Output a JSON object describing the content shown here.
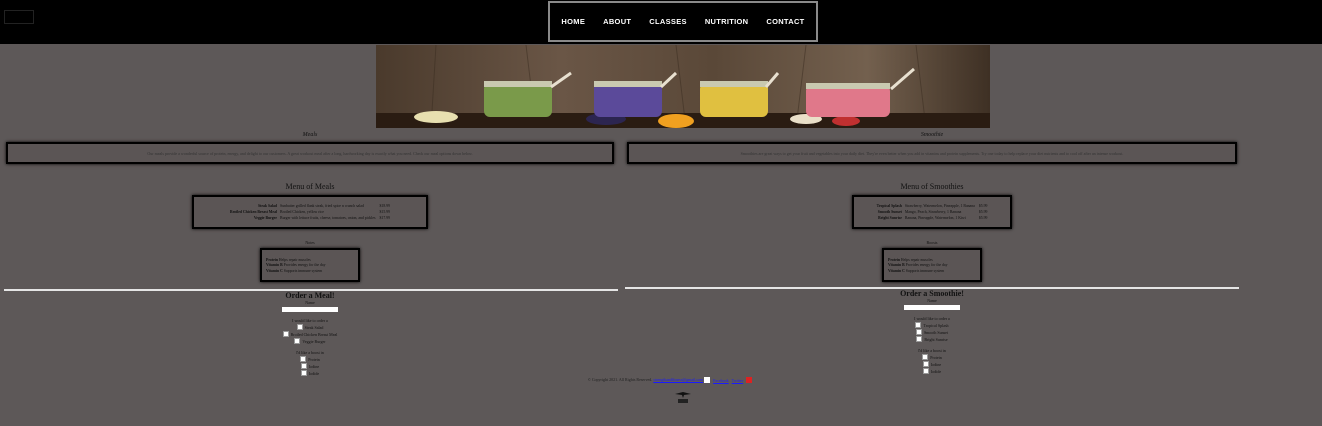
{
  "nav": {
    "items": [
      {
        "label": "HOME"
      },
      {
        "label": "ABOUT"
      },
      {
        "label": "CLASSES"
      },
      {
        "label": "NUTRITION"
      },
      {
        "label": "CONTACT"
      }
    ]
  },
  "meals": {
    "section_label": "Meals",
    "description": "Our meals provide a wonderful source of protein, energy, and delight to our customers. A great workout meal after a long, hardworking day is exactly what you need. Check our meal options down below.",
    "menu_title": "Menu of Meals",
    "menu": [
      {
        "name": "Steak Salad",
        "desc": "Sunbutter grilled flank steak, fried spice n crunch salad",
        "price": "$18.99"
      },
      {
        "name": "Broiled Chicken Breast Meal",
        "desc": "Broiled Chicken, yellow rice",
        "price": "$15.99"
      },
      {
        "name": "Veggie Burger",
        "desc": "Burger with lettuce fruits, cheese, tomatoes, onion, and pickles",
        "price": "$17.99"
      }
    ],
    "benefits_label": "Notes",
    "benefits": [
      {
        "name": "Protein",
        "desc": "Helps repair muscles"
      },
      {
        "name": "Vitamin B",
        "desc": "Provides energy for the day"
      },
      {
        "name": "Vitamin C",
        "desc": "Supports immune system"
      }
    ],
    "order_title": "Order a Meal!",
    "name_label": "Name",
    "choose_label": "I would like to order a",
    "options": [
      "Steak Salad",
      "Broiled Chicken Breast Meal",
      "Veggie Burger"
    ],
    "boost_label": "I'd like a boost in",
    "boosts": [
      "Protein",
      "Iodine",
      "Iodide"
    ]
  },
  "smoothies": {
    "section_label": "Smoothie",
    "description": "Smoothies are great ways to get your fruit and vegetables into your daily diet. They're even better when you add in vitamins and protein supplements. Try one today to help replace your diet nutrients and to cool off after an intense workout.",
    "menu_title": "Menu of Smoothies",
    "menu": [
      {
        "name": "Tropical Splash",
        "desc": "Strawberry, Watermelon, Pineapple, 1 Banana",
        "price": "$5.99"
      },
      {
        "name": "Smooth Sunset",
        "desc": "Mango, Peach, Strawberry, 1 Banana",
        "price": "$5.99"
      },
      {
        "name": "Bright Sunrise",
        "desc": "Banana, Pineapple, Watermelon, 1 Kiwi",
        "price": "$5.99"
      }
    ],
    "benefits_label": "Boosts",
    "benefits": [
      {
        "name": "Protein",
        "desc": "Helps repair muscles"
      },
      {
        "name": "Vitamin B",
        "desc": "Provides energy for the day"
      },
      {
        "name": "Vitamin C",
        "desc": "Supports immune system"
      }
    ],
    "order_title": "Order a Smoothie!",
    "name_label": "Name",
    "choose_label": "I would like to order a",
    "options": [
      "Tropical Splash",
      "Smooth Sunset",
      "Bright Sunrise"
    ],
    "boost_label": "I'd like a boost in",
    "boosts": [
      "Protein",
      "Iodine",
      "Iodide"
    ]
  },
  "footer": {
    "copyright": "© Copyright 2021. All Rights Reserved.",
    "email": "strengthandfitness@gmail.com",
    "links": [
      "Facebook",
      "Twitter"
    ]
  },
  "colors": {
    "background": "#5d5858",
    "topbar": "#000000",
    "nav_border": "#8a8a8a",
    "separator": "#e5e5e5"
  }
}
